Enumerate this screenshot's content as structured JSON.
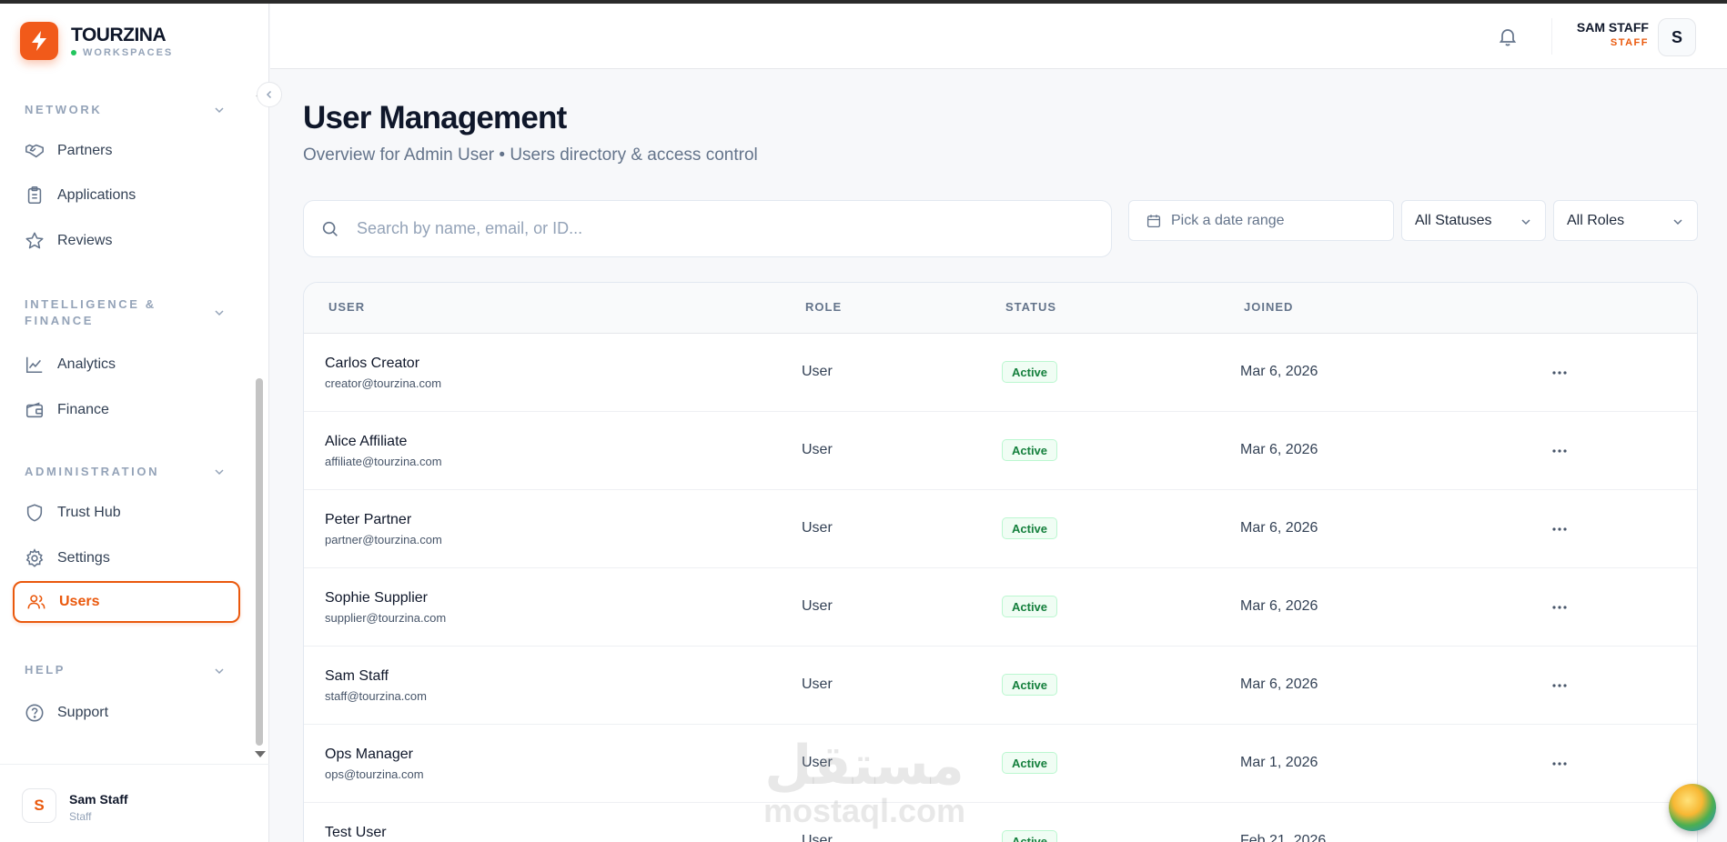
{
  "brand": {
    "name": "TOURZINA",
    "sub": "WORKSPACES"
  },
  "sidebar": {
    "sections": [
      {
        "label": "NETWORK",
        "items": [
          {
            "label": "Partners",
            "icon": "handshake-icon"
          },
          {
            "label": "Applications",
            "icon": "clipboard-icon"
          },
          {
            "label": "Reviews",
            "icon": "star-icon"
          }
        ]
      },
      {
        "label": "INTELLIGENCE & FINANCE",
        "label_line1": "INTELLIGENCE &",
        "label_line2": "FINANCE",
        "items": [
          {
            "label": "Analytics",
            "icon": "line-chart-icon"
          },
          {
            "label": "Finance",
            "icon": "wallet-icon"
          }
        ]
      },
      {
        "label": "ADMINISTRATION",
        "items": [
          {
            "label": "Trust Hub",
            "icon": "shield-icon"
          },
          {
            "label": "Settings",
            "icon": "gear-icon"
          },
          {
            "label": "Users",
            "icon": "users-icon",
            "active": true
          }
        ]
      },
      {
        "label": "HELP",
        "items": [
          {
            "label": "Support",
            "icon": "help-circle-icon"
          }
        ]
      }
    ],
    "footer": {
      "avatar": "S",
      "name": "Sam Staff",
      "role": "Staff"
    }
  },
  "header": {
    "user_name": "SAM STAFF",
    "user_role": "STAFF",
    "avatar": "S"
  },
  "page": {
    "title": "User Management",
    "subtitle": "Overview for Admin User • Users directory & access control"
  },
  "filters": {
    "search_placeholder": "Search by name, email, or ID...",
    "date_placeholder": "Pick a date range",
    "status_select": "All Statuses",
    "role_select": "All Roles"
  },
  "table": {
    "columns": [
      "USER",
      "ROLE",
      "STATUS",
      "JOINED"
    ],
    "rows": [
      {
        "name": "Carlos Creator",
        "email": "creator@tourzina.com",
        "role": "User",
        "status": "Active",
        "joined": "Mar 6, 2026"
      },
      {
        "name": "Alice Affiliate",
        "email": "affiliate@tourzina.com",
        "role": "User",
        "status": "Active",
        "joined": "Mar 6, 2026"
      },
      {
        "name": "Peter Partner",
        "email": "partner@tourzina.com",
        "role": "User",
        "status": "Active",
        "joined": "Mar 6, 2026"
      },
      {
        "name": "Sophie Supplier",
        "email": "supplier@tourzina.com",
        "role": "User",
        "status": "Active",
        "joined": "Mar 6, 2026"
      },
      {
        "name": "Sam Staff",
        "email": "staff@tourzina.com",
        "role": "User",
        "status": "Active",
        "joined": "Mar 6, 2026"
      },
      {
        "name": "Ops Manager",
        "email": "ops@tourzina.com",
        "role": "User",
        "status": "Active",
        "joined": "Mar 1, 2026"
      },
      {
        "name": "Test User",
        "email": "",
        "role": "User",
        "status": "Active",
        "joined": "Feb 21, 2026"
      }
    ]
  },
  "watermark": {
    "arabic": "مستقل",
    "latin": "mostaql.com"
  },
  "colors": {
    "accent": "#ea580c",
    "brand": "#f15a1a",
    "success": "#15803d"
  }
}
